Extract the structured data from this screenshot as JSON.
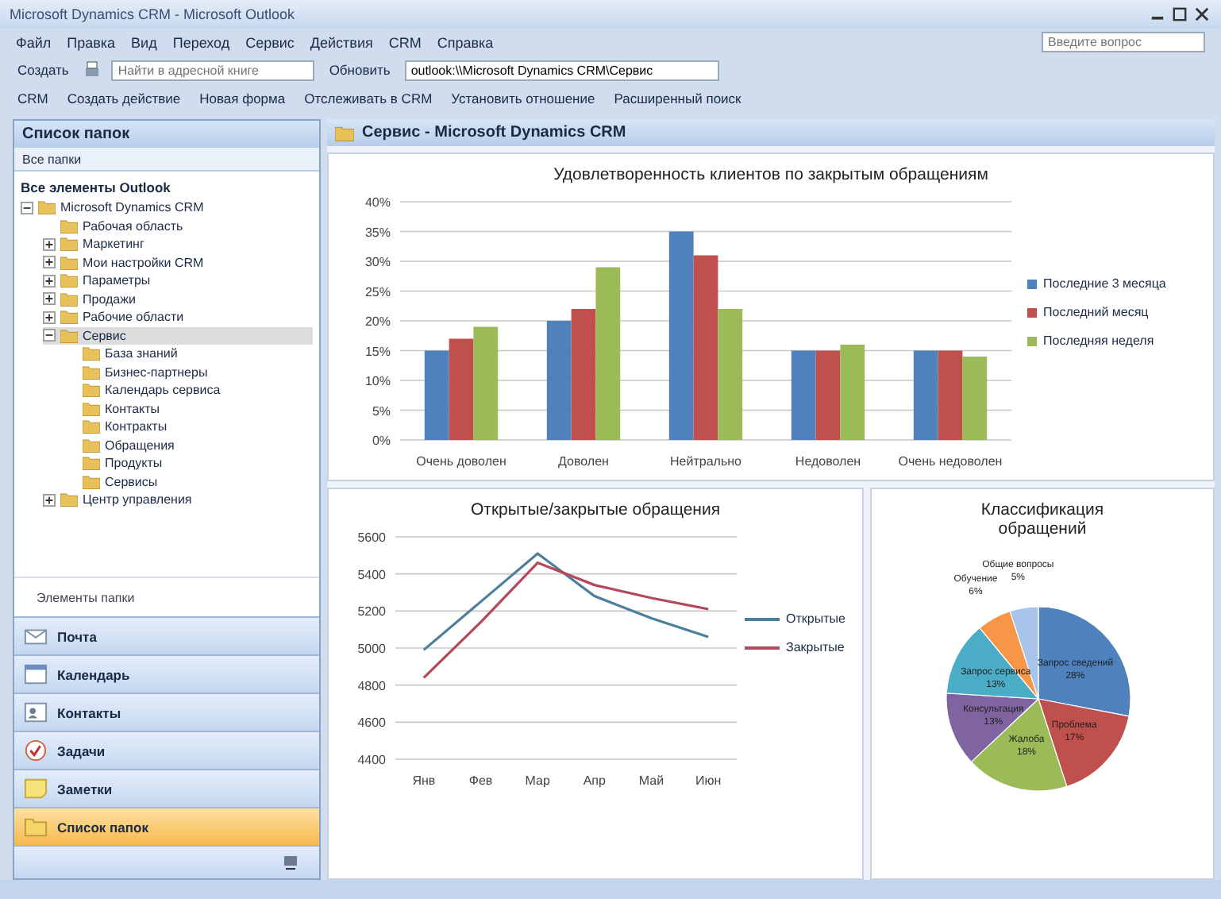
{
  "window": {
    "title": "Microsoft Dynamics CRM - Microsoft Outlook"
  },
  "menu": [
    "Файл",
    "Правка",
    "Вид",
    "Переход",
    "Сервис",
    "Действия",
    "CRM",
    "Справка"
  ],
  "help_search": {
    "placeholder": "Введите вопрос"
  },
  "toolbar": {
    "new_button": "Создать",
    "address_book": {
      "placeholder": "Найти в адресной книге"
    },
    "refresh_button": "Обновить",
    "address": "outlook:\\\\Microsoft Dynamics CRM\\Сервис"
  },
  "crm_toolbar": [
    "CRM",
    "Создать действие",
    "Новая форма",
    "Отслеживать в CRM",
    "Установить отношение",
    "Расширенный поиск"
  ],
  "sidebar": {
    "title": "Список папок",
    "folders_dropdown": "Все папки",
    "all_items": "Все элементы Outlook",
    "tree": [
      {
        "label": "Microsoft Dynamics CRM",
        "expanded": true,
        "selected": false,
        "children": [
          {
            "label": "Рабочая область",
            "selected": false
          },
          {
            "label": "Маркетинг",
            "expanded": false,
            "selected": false
          },
          {
            "label": "Мои настройки CRM",
            "expanded": false,
            "selected": false
          },
          {
            "label": "Параметры",
            "expanded": false,
            "selected": false
          },
          {
            "label": "Продажи",
            "expanded": false,
            "selected": false
          },
          {
            "label": "Рабочие области",
            "expanded": false,
            "selected": false
          },
          {
            "label": "Сервис",
            "expanded": true,
            "selected": true,
            "children": [
              {
                "label": "База знаний",
                "selected": false
              },
              {
                "label": "Бизнес-партнеры",
                "selected": false
              },
              {
                "label": "Календарь сервиса",
                "selected": false
              },
              {
                "label": "Контакты",
                "selected": false
              },
              {
                "label": "Контракты",
                "selected": false
              },
              {
                "label": "Обращения",
                "selected": false
              },
              {
                "label": "Продукты",
                "selected": false
              },
              {
                "label": "Сервисы",
                "selected": false
              }
            ]
          },
          {
            "label": "Центр управления",
            "expanded": false,
            "selected": false
          }
        ]
      }
    ],
    "folder_items": "Элементы папки",
    "nav_buttons": [
      {
        "label": "Почта",
        "kind": "mail",
        "selected": false
      },
      {
        "label": "Календарь",
        "kind": "calendar",
        "selected": false
      },
      {
        "label": "Контакты",
        "kind": "contacts",
        "selected": false
      },
      {
        "label": "Задачи",
        "kind": "tasks",
        "selected": false
      },
      {
        "label": "Заметки",
        "kind": "notes",
        "selected": false
      },
      {
        "label": "Список папок",
        "kind": "folders",
        "selected": true
      }
    ]
  },
  "content": {
    "header": "Сервис - Microsoft Dynamics CRM",
    "bar_panel": {
      "chart_data": {
        "type": "bar",
        "title": "Удовлетворенность клиентов по закрытым обращениям",
        "categories": [
          "Очень доволен",
          "Доволен",
          "Нейтрально",
          "Недоволен",
          "Очень недоволен"
        ],
        "series": [
          {
            "name": "Последние 3 месяца",
            "color": "#4f81bd",
            "values": [
              15,
              20,
              35,
              15,
              15
            ]
          },
          {
            "name": "Последний месяц",
            "color": "#c0504d",
            "values": [
              17,
              22,
              31,
              15,
              15
            ]
          },
          {
            "name": "Последняя неделя",
            "color": "#9bbb59",
            "values": [
              19,
              29,
              22,
              16,
              14
            ]
          }
        ],
        "grid": true,
        "legend": true,
        "ylim": [
          0,
          40
        ],
        "yticks": [
          {
            "value": 0,
            "label": "0%"
          },
          {
            "value": 5,
            "label": "5%"
          },
          {
            "value": 10,
            "label": "10%"
          },
          {
            "value": 15,
            "label": "15%"
          },
          {
            "value": 20,
            "label": "20%"
          },
          {
            "value": 25,
            "label": "25%"
          },
          {
            "value": 30,
            "label": "30%"
          },
          {
            "value": 35,
            "label": "35%"
          },
          {
            "value": 40,
            "label": "40%"
          }
        ]
      }
    },
    "line_panel": {
      "chart_data": {
        "type": "line",
        "title": "Открытые/закрытые обращения",
        "categories": [
          "Янв",
          "Фев",
          "Мар",
          "Апр",
          "Май",
          "Июн"
        ],
        "series": [
          {
            "name": "Открытые",
            "color": "#4b7f9c",
            "values": [
              4990,
              5250,
              5510,
              5280,
              5160,
              5060
            ]
          },
          {
            "name": "Закрытые",
            "color": "#b5475a",
            "values": [
              4840,
              5140,
              5460,
              5340,
              5270,
              5210
            ]
          }
        ],
        "grid": true,
        "legend": true,
        "ylim": [
          4400,
          5600
        ],
        "yticks": [
          4400,
          4600,
          4800,
          5000,
          5200,
          5400,
          5600
        ]
      }
    },
    "pie_panel": {
      "chart_data": {
        "type": "pie",
        "title": "Классификация обращений",
        "categories": [
          "Запрос сведений",
          "Проблема",
          "Жалоба",
          "Консультация",
          "Запрос сервиса",
          "Обучение",
          "Общие вопросы"
        ],
        "values": [
          28,
          17,
          18,
          13,
          13,
          6,
          5
        ],
        "colors": [
          "#4f81bd",
          "#c0504d",
          "#9bbb59",
          "#8064a2",
          "#4bacc6",
          "#f79646",
          "#a9c4eb"
        ],
        "value_labels": [
          "28%",
          "17%",
          "18%",
          "13%",
          "13%",
          "6%",
          "5%"
        ]
      }
    }
  }
}
